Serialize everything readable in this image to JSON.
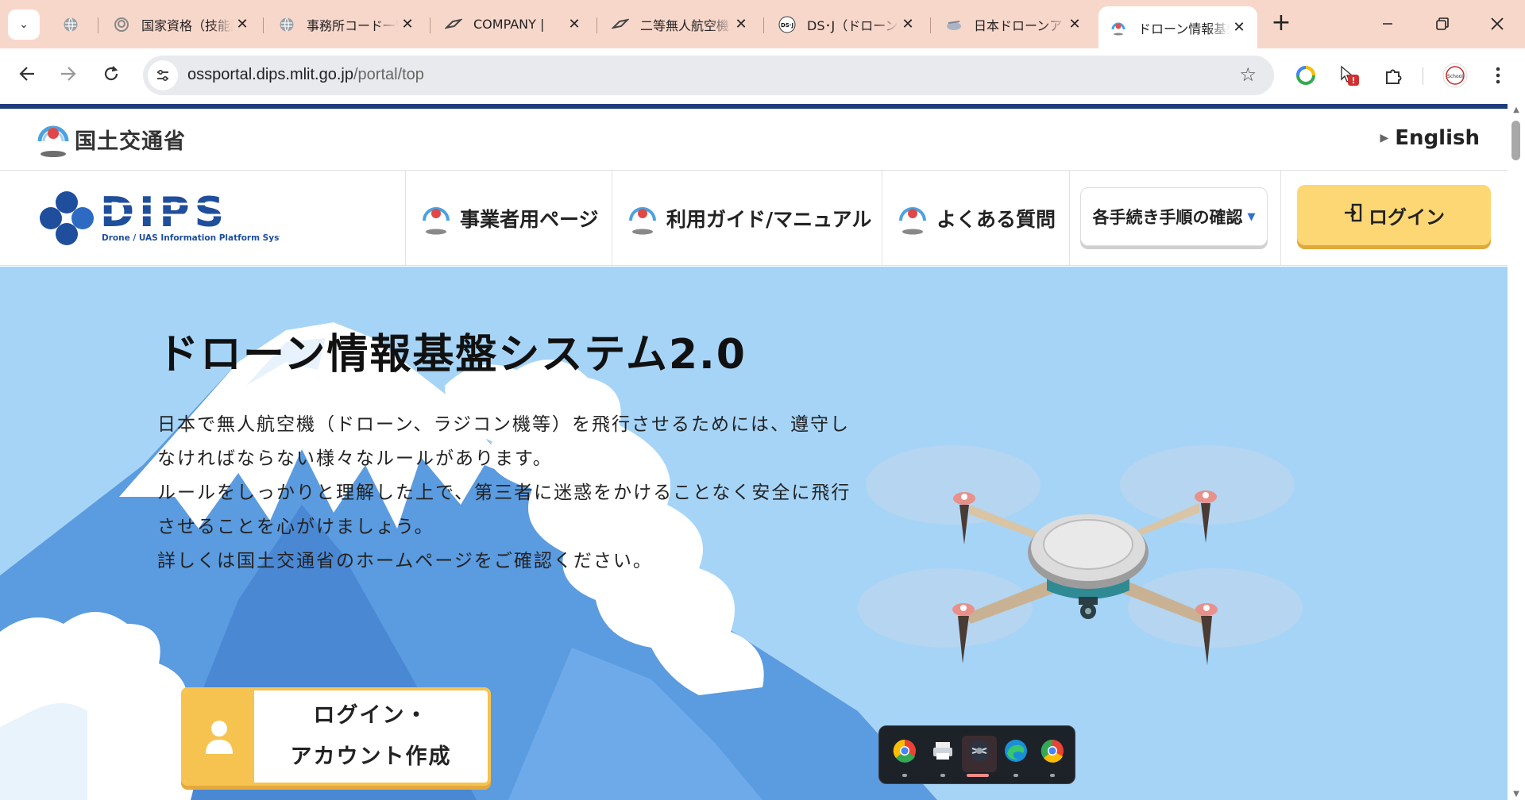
{
  "browser": {
    "tabs": [
      {
        "title": "",
        "icon": "globe-icon"
      },
      {
        "title": "国家資格（技能証明）",
        "icon": "ministry-icon"
      },
      {
        "title": "事務所コード一覧",
        "icon": "globe-icon"
      },
      {
        "title": "COMPANY |",
        "icon": "drone-logo-icon"
      },
      {
        "title": "二等無人航空機",
        "icon": "drone-logo-icon"
      },
      {
        "title": "DS･J（ドローン",
        "icon": "dsj-icon"
      },
      {
        "title": "日本ドローンア",
        "icon": "drone-cloud-icon"
      },
      {
        "title": "ドローン情報基盤",
        "icon": "ministry-icon",
        "active": true
      }
    ],
    "url_host": "ossportal.dips.mlit.go.jp",
    "url_path": "/portal/top",
    "alert_badge": "!"
  },
  "header": {
    "ministry_name": "国土交通省",
    "english_link": "English"
  },
  "nav": {
    "logo_text": "DIPS",
    "logo_subtitle": "Drone / UAS Information Platform System",
    "items": [
      {
        "label": "事業者用ページ"
      },
      {
        "label": "利用ガイド/マニュアル"
      },
      {
        "label": "よくある質問"
      }
    ],
    "procedure_button": "各手続き手順の確認",
    "login_button": "ログイン"
  },
  "hero": {
    "title": "ドローン情報基盤システム2.0",
    "paragraph_lines": [
      "日本で無人航空機（ドローン、ラジコン機等）を飛行させるためには、遵守し",
      "なければならない様々なルールがあります。",
      "ルールをしっかりと理解した上で、第三者に迷惑をかけることなく安全に飛行",
      "させることを心がけましょう。",
      "詳しくは国土交通省のホームページをご確認ください。"
    ],
    "account_button_line1": "ログイン・",
    "account_button_line2": "アカウント作成"
  },
  "colors": {
    "hero_sky": "#a6d4f7",
    "login_yellow": "#fcd774",
    "account_yellow": "#f6c350",
    "tabstrip": "#f8d7cb",
    "header_strip": "#1e3d7c",
    "logo_blue": "#1f4e9c"
  },
  "dock": {
    "apps": [
      "chrome-icon",
      "printer-icon",
      "drone-app-icon",
      "edge-icon",
      "chrome-dev-icon"
    ],
    "active_index": 2
  }
}
